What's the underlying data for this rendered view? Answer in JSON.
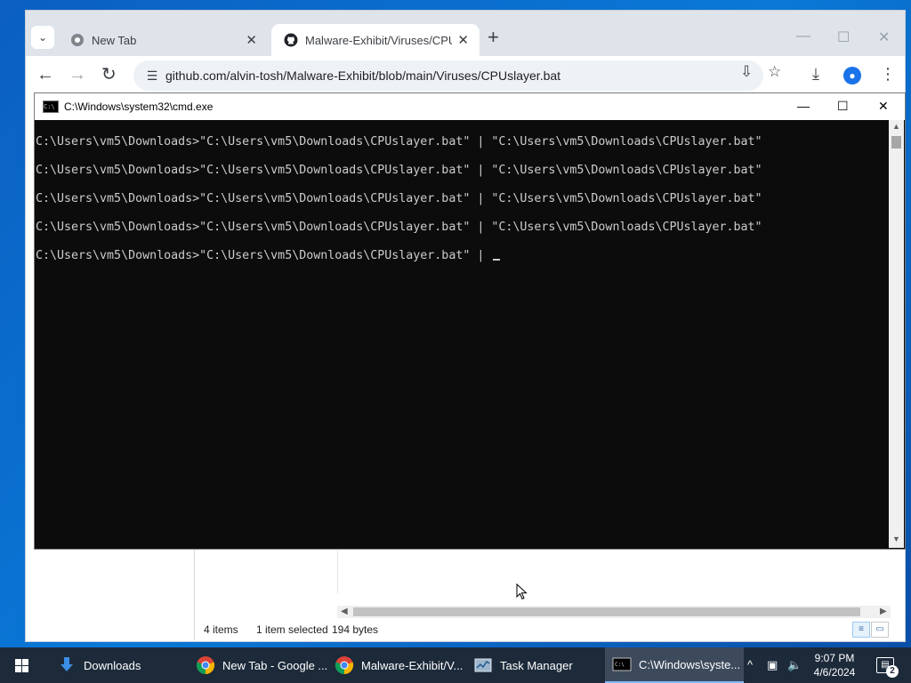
{
  "browser": {
    "tabs": [
      {
        "label": "New Tab",
        "close": "✕"
      },
      {
        "label": "Malware-Exhibit/Viruses/CPUsl",
        "close": "✕"
      }
    ],
    "new_tab": "+",
    "window_controls": {
      "minimize": "—",
      "maximize": "☐",
      "close": "✕"
    },
    "url": "github.com/alvin-tosh/Malware-Exhibit/blob/main/Viruses/CPUslayer.bat",
    "nav": {
      "back": "←",
      "forward": "→",
      "reload": "↻"
    }
  },
  "cmd": {
    "title": "C:\\Windows\\system32\\cmd.exe",
    "icon_text": "C:\\",
    "controls": {
      "minimize": "—",
      "maximize": "☐",
      "close": "✕"
    },
    "lines": [
      "C:\\Users\\vm5\\Downloads>\"C:\\Users\\vm5\\Downloads\\CPUslayer.bat\" | \"C:\\Users\\vm5\\Downloads\\CPUslayer.bat\"",
      "C:\\Users\\vm5\\Downloads>\"C:\\Users\\vm5\\Downloads\\CPUslayer.bat\" | \"C:\\Users\\vm5\\Downloads\\CPUslayer.bat\"",
      "C:\\Users\\vm5\\Downloads>\"C:\\Users\\vm5\\Downloads\\CPUslayer.bat\" | \"C:\\Users\\vm5\\Downloads\\CPUslayer.bat\"",
      "C:\\Users\\vm5\\Downloads>\"C:\\Users\\vm5\\Downloads\\CPUslayer.bat\" | \"C:\\Users\\vm5\\Downloads\\CPUslayer.bat\"",
      "C:\\Users\\vm5\\Downloads>\"C:\\Users\\vm5\\Downloads\\CPUslayer.bat\" | "
    ]
  },
  "explorer": {
    "status": {
      "items": "4 items",
      "selected": "1 item selected",
      "size": "194 bytes"
    }
  },
  "taskbar": {
    "items": [
      {
        "label": "Downloads",
        "icon": "download-arrow-icon"
      },
      {
        "label": "New Tab - Google ...",
        "icon": "chrome-icon"
      },
      {
        "label": "Malware-Exhibit/V...",
        "icon": "chrome-icon"
      },
      {
        "label": "Task Manager",
        "icon": "task-manager-icon"
      },
      {
        "label": "C:\\Windows\\syste...",
        "icon": "cmd-icon",
        "active": true
      }
    ],
    "clock": {
      "time": "9:07 PM",
      "date": "4/6/2024"
    },
    "notifications": "2"
  },
  "colors": {
    "console_bg": "#0c0c0c",
    "console_text": "#cccccc",
    "taskbar_bg": "#1c2a3a",
    "desktop_blue": "#0a78d7"
  }
}
